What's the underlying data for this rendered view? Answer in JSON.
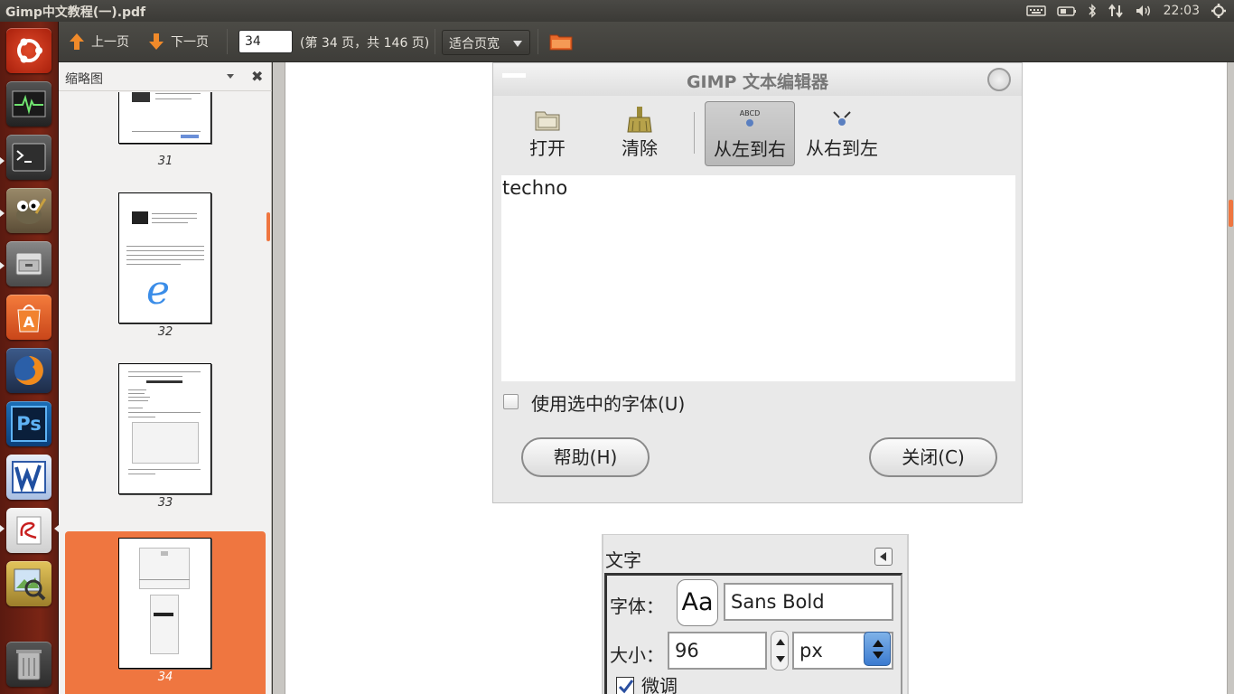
{
  "window": {
    "title": "Gimp中文教程(一).pdf"
  },
  "panel": {
    "clock": "22:03"
  },
  "launcher": {
    "items": [
      "ubuntu-logo",
      "system-monitor",
      "terminal",
      "gimp",
      "file-manager",
      "software-center",
      "firefox",
      "photoshop",
      "wps-writer",
      "document-viewer",
      "image-viewer",
      "trash"
    ]
  },
  "toolbar": {
    "prev_label": "上一页",
    "next_label": "下一页",
    "page_value": "34",
    "page_info": "(第 34 页，共 146 页)",
    "zoom_label": "适合页宽"
  },
  "sidebar": {
    "title": "缩略图",
    "thumbnails": [
      {
        "num": "31"
      },
      {
        "num": "32"
      },
      {
        "num": "33"
      },
      {
        "num": "34"
      }
    ]
  },
  "dialog": {
    "title": "GIMP 文本编辑器",
    "tools": {
      "open": "打开",
      "clear": "清除",
      "ltr": "从左到右",
      "rtl": "从右到左"
    },
    "text_content": "techno",
    "use_font_label": "使用选中的字体(U)",
    "help_button": "帮助(H)",
    "close_button": "关闭(C)"
  },
  "text_panel": {
    "title": "文字",
    "font_label": "字体：",
    "font_preview": "Aa",
    "font_value": "Sans Bold",
    "size_label": "大小：",
    "size_value": "96",
    "unit_value": "px",
    "hinting_label": "微调"
  },
  "colors": {
    "accent": "#ef7640",
    "launcher_bg": "#7a2515",
    "panel_bg": "#3c3b37"
  }
}
